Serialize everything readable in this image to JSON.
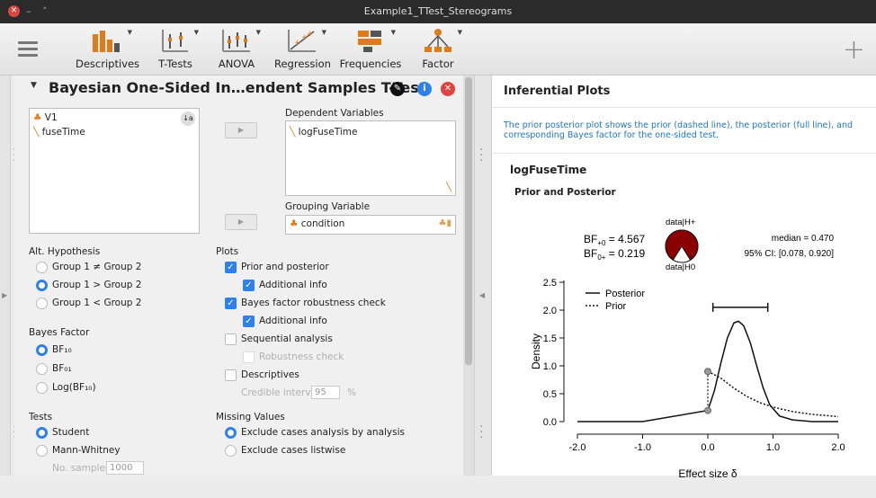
{
  "window": {
    "title": "Example1_TTest_Stereograms"
  },
  "toolbar": {
    "items": [
      {
        "label": "Descriptives",
        "icon": "descriptives-icon"
      },
      {
        "label": "T-Tests",
        "icon": "t-tests-icon"
      },
      {
        "label": "ANOVA",
        "icon": "anova-icon"
      },
      {
        "label": "Regression",
        "icon": "regression-icon"
      },
      {
        "label": "Frequencies",
        "icon": "frequencies-icon"
      },
      {
        "label": "Factor",
        "icon": "factor-icon"
      }
    ],
    "plus": "+"
  },
  "analysis": {
    "title": "Bayesian One-Sided In…endent Samples T-Test",
    "variables": [
      "V1",
      "fuseTime"
    ],
    "dependent_label": "Dependent Variables",
    "dependent_value": "logFuseTime",
    "grouping_label": "Grouping Variable",
    "grouping_value": "condition",
    "alt_hypothesis": {
      "label": "Alt. Hypothesis",
      "options": [
        "Group 1 ≠ Group 2",
        "Group 1 > Group 2",
        "Group 1 < Group 2"
      ],
      "selected": 1
    },
    "bayes_factor": {
      "label": "Bayes Factor",
      "options": [
        "BF₁₀",
        "BF₀₁",
        "Log(BF₁₀)"
      ],
      "selected": 0
    },
    "tests": {
      "label": "Tests",
      "options": [
        "Student",
        "Mann-Whitney"
      ],
      "selected": 0,
      "samples_label": "No. samples",
      "samples_value": "1000"
    },
    "plots": {
      "label": "Plots",
      "prior_posterior": "Prior and posterior",
      "additional_info_1": "Additional info",
      "robustness": "Bayes factor robustness check",
      "additional_info_2": "Additional info",
      "sequential": "Sequential analysis",
      "robustness_check": "Robustness check",
      "descriptives": "Descriptives",
      "credible_interval_label": "Credible interval",
      "credible_interval_value": "95",
      "percent": "%"
    },
    "missing": {
      "label": "Missing Values",
      "options": [
        "Exclude cases analysis by analysis",
        "Exclude cases listwise"
      ],
      "selected": 0
    }
  },
  "results": {
    "heading": "Inferential Plots",
    "description": "The prior posterior plot shows the prior (dashed line), the posterior (full line), and corresponding Bayes factor for the one-sided test.",
    "variable": "logFuseTime",
    "plot_title": "Prior and Posterior",
    "bf_plus0_label": "BF",
    "bf_plus0_sub": "+0",
    "bf_plus0_value": " = 4.567",
    "bf_0plus_label": "BF",
    "bf_0plus_sub": "0+",
    "bf_0plus_value": " = 0.219",
    "pie_top": "data|H+",
    "pie_bottom": "data|H0",
    "median": "median = 0.470",
    "ci": "95% CI: [0.078, 0.920]",
    "legend_posterior": "Posterior",
    "legend_prior": "Prior",
    "ylabel": "Density",
    "xlabel": "Effect size δ",
    "x_ticks": [
      "-2.0",
      "-1.0",
      "0.0",
      "1.0",
      "2.0"
    ],
    "y_ticks": [
      "0.0",
      "0.5",
      "1.0",
      "1.5",
      "2.0",
      "2.5"
    ],
    "pie_fraction_h_plus": 0.82
  },
  "chart_data": {
    "type": "line",
    "xlabel": "Effect size δ",
    "ylabel": "Density",
    "xlim": [
      -2,
      2
    ],
    "ylim": [
      0,
      2.5
    ],
    "series": [
      {
        "name": "Posterior",
        "style": "solid",
        "x": [
          -2.0,
          -1.0,
          0.0,
          0.1,
          0.2,
          0.3,
          0.4,
          0.47,
          0.55,
          0.65,
          0.75,
          0.85,
          0.95,
          1.1,
          1.3,
          1.6,
          2.0
        ],
        "y": [
          0,
          0,
          0.2,
          0.55,
          1.05,
          1.5,
          1.77,
          1.8,
          1.72,
          1.42,
          1.0,
          0.6,
          0.3,
          0.1,
          0.03,
          0.0,
          0.0
        ]
      },
      {
        "name": "Prior",
        "style": "dashed",
        "x": [
          0.0,
          0.2,
          0.4,
          0.6,
          0.8,
          1.0,
          1.3,
          1.6,
          2.0
        ],
        "y": [
          0.9,
          0.78,
          0.6,
          0.45,
          0.34,
          0.26,
          0.18,
          0.13,
          0.09
        ]
      }
    ],
    "credible_interval": [
      0.078,
      0.92
    ],
    "points": [
      {
        "x": 0.0,
        "y": 0.9
      },
      {
        "x": 0.0,
        "y": 0.2
      }
    ]
  }
}
